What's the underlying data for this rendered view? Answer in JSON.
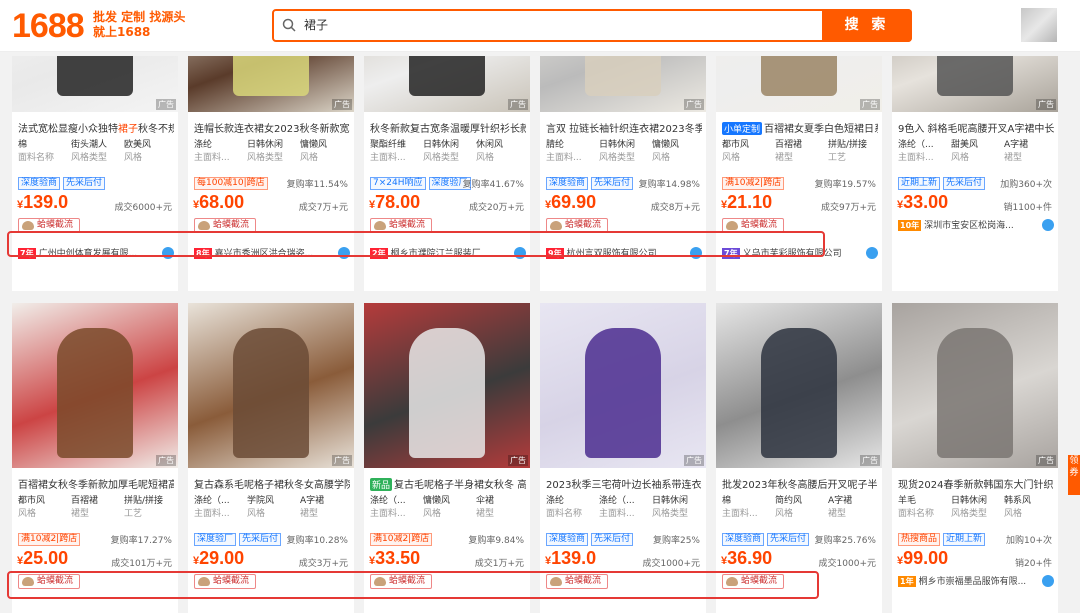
{
  "header": {
    "logo": "1688",
    "slogan_line1": "批发 定制 找源头",
    "slogan_line2": "就上1688",
    "search_value": "裙子",
    "search_button": "搜 索"
  },
  "common": {
    "toad_label": "蛤蟆截流",
    "ad": "广告"
  },
  "row1": [
    {
      "title_pre": "法式宽松显瘦小众独特",
      "title_hl": "裙子",
      "title_post": "秋冬不规",
      "attrs": [
        [
          "棉",
          "面料名称"
        ],
        [
          "街头潮人",
          "风格类型"
        ],
        [
          "欧美风",
          "风格"
        ]
      ],
      "badges": [
        [
          "blue",
          "深度验商"
        ],
        [
          "blue",
          "先采后付"
        ]
      ],
      "repurchase": "",
      "price": "139.0",
      "sold": "成交6000+元",
      "shop_year": "7年",
      "shop": "广州中创体育发展有限..."
    },
    {
      "title_pre": "连帽长款连衣裙女2023秋冬新款宽松",
      "attrs": [
        [
          "涤纶",
          "主面料..."
        ],
        [
          "日韩休闲",
          "风格类型"
        ],
        [
          "慵懒风",
          "风格"
        ]
      ],
      "badges": [
        [
          "red",
          "每100减10|跨店"
        ]
      ],
      "repurchase": "复购率11.54%",
      "price": "68.00",
      "sold": "成交7万+元",
      "shop_year": "8年",
      "shop": "嘉兴市秀洲区洪合瑞姿..."
    },
    {
      "title_pre": "秋冬新款复古宽条温暖厚针织衫长款",
      "attrs": [
        [
          "聚酯纤维",
          "主面料..."
        ],
        [
          "日韩休闲",
          "风格类型"
        ],
        [
          "休闲风",
          "风格"
        ]
      ],
      "badges": [
        [
          "blue",
          "7×24H响应"
        ],
        [
          "blue",
          "深度验厂"
        ]
      ],
      "repurchase": "复购率41.67%",
      "price": "78.00",
      "sold": "成交20万+元",
      "shop_year": "2年",
      "shop": "桐乡市濮院汀兰服装厂"
    },
    {
      "title_pre": "言双 拉链长袖针织连衣裙2023冬季",
      "attrs": [
        [
          "腈纶",
          "主面料..."
        ],
        [
          "日韩休闲",
          "风格类型"
        ],
        [
          "慵懒风",
          "风格"
        ]
      ],
      "badges": [
        [
          "blue",
          "深度验商"
        ],
        [
          "blue",
          "先采后付"
        ]
      ],
      "repurchase": "复购率14.98%",
      "price": "69.90",
      "sold": "成交8万+元",
      "shop_year": "9年",
      "shop": "杭州言双服饰有限公司"
    },
    {
      "chip": "小单定制",
      "title_pre": "百褶裙女夏季白色短裙日系",
      "attrs": [
        [
          "都市风",
          "风格"
        ],
        [
          "百褶裙",
          "裙型"
        ],
        [
          "拼贴/拼接",
          "工艺"
        ]
      ],
      "badges": [
        [
          "red",
          "满10减2|跨店"
        ]
      ],
      "repurchase": "复购率19.57%",
      "price": "21.10",
      "sold": "成交97万+元",
      "shop_year": "7年",
      "shop": "义乌市芙彩服饰有限公司"
    },
    {
      "title_pre": "9色入 斜格毛呢高腰开叉A字裙中长...",
      "attrs": [
        [
          "涤纶（...",
          "主面料..."
        ],
        [
          "甜美风",
          "风格"
        ],
        [
          "A字裙",
          "裙型"
        ]
      ],
      "badges": [
        [
          "blue",
          "近期上新"
        ],
        [
          "blue",
          "先采后付"
        ]
      ],
      "repurchase": "加购360+次",
      "price": "33.00",
      "sold": "销1100+件",
      "shop_year": "10年",
      "shop": "深圳市宝安区松岗海..."
    }
  ],
  "row2": [
    {
      "title_pre": "百褶裙女秋冬季新款加厚毛呢短裙高",
      "attrs": [
        [
          "都市风",
          "风格"
        ],
        [
          "百褶裙",
          "裙型"
        ],
        [
          "拼贴/拼接",
          "工艺"
        ]
      ],
      "badges": [
        [
          "red",
          "满10减2|跨店"
        ]
      ],
      "repurchase": "复购率17.27%",
      "price": "25.00",
      "sold": "成交101万+元"
    },
    {
      "title_pre": "复古森系毛呢格子裙秋冬女高腰学院",
      "attrs": [
        [
          "涤纶（...",
          "主面料..."
        ],
        [
          "学院风",
          "风格"
        ],
        [
          "A字裙",
          "裙型"
        ]
      ],
      "badges": [
        [
          "blue",
          "深度验厂"
        ],
        [
          "blue",
          "先采后付"
        ]
      ],
      "repurchase": "复购率10.28%",
      "price": "29.00",
      "sold": "成交3万+元"
    },
    {
      "chip": "新品",
      "title_pre": "复古毛呢格子半身裙女秋冬 高",
      "attrs": [
        [
          "涤纶（...",
          "主面料..."
        ],
        [
          "慵懒风",
          "风格"
        ],
        [
          "伞裙",
          "裙型"
        ]
      ],
      "badges": [
        [
          "red",
          "满10减2|跨店"
        ]
      ],
      "repurchase": "复购率9.84%",
      "price": "33.50",
      "sold": "成交1万+元"
    },
    {
      "title_pre": "2023秋季三宅荷叶边长袖系带连衣裙",
      "attrs": [
        [
          "涤纶",
          "面料名称"
        ],
        [
          "涤纶（...",
          "主面料..."
        ],
        [
          "日韩休闲",
          "风格类型"
        ]
      ],
      "badges": [
        [
          "blue",
          "深度验商"
        ],
        [
          "blue",
          "先采后付"
        ]
      ],
      "repurchase": "复购率25%",
      "price": "139.0",
      "sold": "成交1000+元"
    },
    {
      "title_pre": "批发2023年秋冬高腰后开叉呢子半身裙",
      "attrs": [
        [
          "棉",
          "主面料..."
        ],
        [
          "简约风",
          "风格"
        ],
        [
          "A字裙",
          "裙型"
        ]
      ],
      "badges": [
        [
          "blue",
          "深度验商"
        ],
        [
          "blue",
          "先采后付"
        ]
      ],
      "repurchase": "复购率25.76%",
      "price": "36.90",
      "sold": "成交1000+元"
    },
    {
      "title_pre": "现货2024春季新款韩国东大门针织...",
      "attrs": [
        [
          "羊毛",
          "面料名称"
        ],
        [
          "日韩休闲",
          "风格类型"
        ],
        [
          "韩系风",
          "风格"
        ]
      ],
      "badges": [
        [
          "red",
          "热搜商品"
        ],
        [
          "blue",
          "近期上新"
        ]
      ],
      "repurchase": "加购10+次",
      "price": "99.00",
      "sold": "销20+件",
      "shop_year": "1年",
      "shop": "桐乡市崇福墨品服饰有限..."
    }
  ],
  "side_tab": "领 券",
  "colors": {
    "brand": "#ff5a00",
    "price": "#ff4400",
    "highlight": "#e53935"
  }
}
